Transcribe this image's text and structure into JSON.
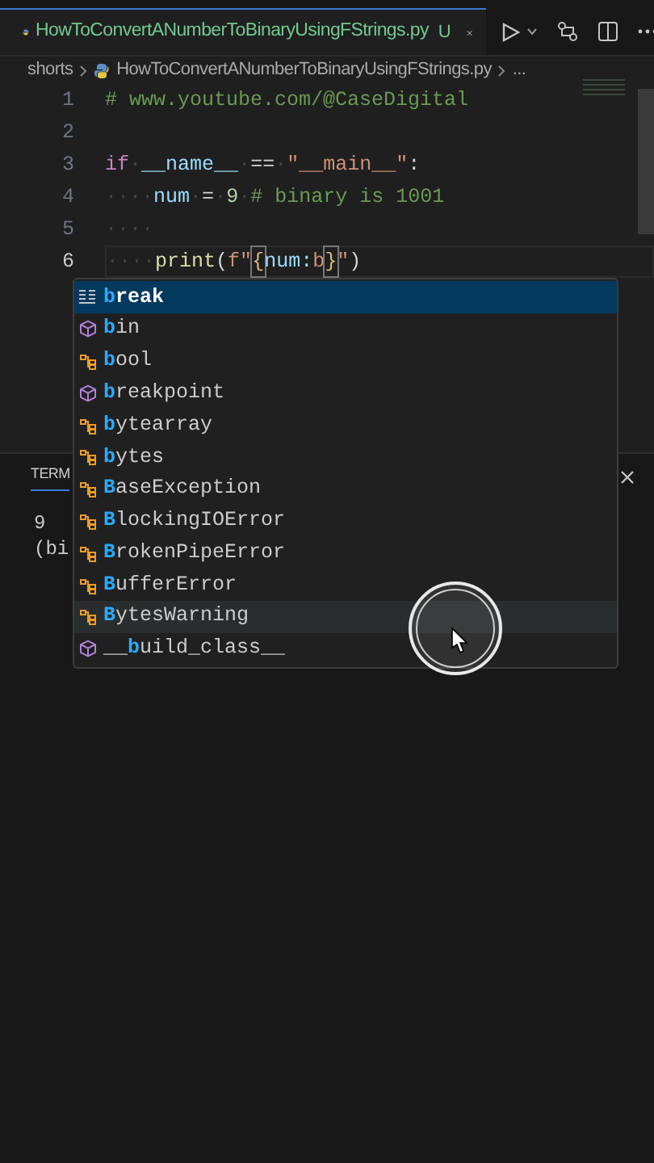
{
  "tab": {
    "filename": "HowToConvertANumberToBinaryUsingFStrings.py",
    "status": "U",
    "selected": true
  },
  "breadcrumb": [
    {
      "text": "shorts"
    },
    {
      "text": "HowToConvertANumberToBinaryUsingFStrings.py",
      "kind": "file"
    },
    {
      "text": "..."
    }
  ],
  "code_lines": [
    {
      "number": "1",
      "active": false,
      "tokens": [
        {
          "kind": "comment",
          "text": "# www.youtube.com/@CaseDigital"
        }
      ]
    },
    {
      "number": "2",
      "active": false
    },
    {
      "number": "3",
      "active": false,
      "tokens": [
        {
          "kind": "keyword",
          "text": "if"
        },
        {
          "kind": "space",
          "text": "·"
        },
        {
          "kind": "name",
          "text": "__name__"
        },
        {
          "kind": "space",
          "text": "·"
        },
        {
          "kind": "op",
          "text": "=="
        },
        {
          "kind": "space",
          "text": "·"
        },
        {
          "kind": "string",
          "text": "\"__main__\""
        },
        {
          "kind": "op",
          "text": ":"
        }
      ]
    },
    {
      "number": "4",
      "active": false,
      "tokens": [
        {
          "kind": "space",
          "text": "····"
        },
        {
          "kind": "name",
          "text": "num"
        },
        {
          "kind": "space",
          "text": "·"
        },
        {
          "kind": "op",
          "text": "="
        },
        {
          "kind": "space",
          "text": "·"
        },
        {
          "kind": "number",
          "text": "9"
        },
        {
          "kind": "space",
          "text": "·"
        },
        {
          "kind": "comment",
          "text": "# binary is 1001"
        }
      ]
    },
    {
      "number": "5",
      "active": false,
      "tokens": [
        {
          "kind": "space",
          "text": "····"
        }
      ]
    },
    {
      "number": "6",
      "active": true,
      "tokens": [
        {
          "kind": "space",
          "text": "····"
        },
        {
          "kind": "func",
          "text": "print"
        },
        {
          "kind": "op",
          "text": "("
        },
        {
          "kind": "string",
          "text": "f\""
        },
        {
          "kind": "bracket",
          "text": "{"
        },
        {
          "kind": "name",
          "text": "num:"
        },
        {
          "kind": "string",
          "text": "b"
        },
        {
          "kind": "bracket",
          "text": "}"
        },
        {
          "kind": "string",
          "text": "\""
        },
        {
          "kind": "op",
          "text": ")"
        }
      ]
    }
  ],
  "suggestions": [
    {
      "kind": "keyword",
      "match": "b",
      "rest": "reak",
      "selected": true,
      "hovered": false
    },
    {
      "kind": "function",
      "match": "b",
      "rest": "in",
      "selected": false,
      "hovered": false
    },
    {
      "kind": "class",
      "match": "b",
      "rest": "ool",
      "selected": false,
      "hovered": false
    },
    {
      "kind": "function",
      "match": "b",
      "rest": "reakpoint",
      "selected": false,
      "hovered": false
    },
    {
      "kind": "class",
      "match": "b",
      "rest": "ytearray",
      "selected": false,
      "hovered": false
    },
    {
      "kind": "class",
      "match": "b",
      "rest": "ytes",
      "selected": false,
      "hovered": false
    },
    {
      "kind": "class",
      "match": "B",
      "rest": "aseException",
      "selected": false,
      "hovered": false
    },
    {
      "kind": "class",
      "match": "B",
      "rest": "lockingIOError",
      "selected": false,
      "hovered": false
    },
    {
      "kind": "class",
      "match": "B",
      "rest": "rokenPipeError",
      "selected": false,
      "hovered": false
    },
    {
      "kind": "class",
      "match": "B",
      "rest": "ufferError",
      "selected": false,
      "hovered": false
    },
    {
      "kind": "class",
      "match": "B",
      "rest": "ytesWarning",
      "selected": false,
      "hovered": true
    },
    {
      "kind": "function",
      "lead": "__",
      "match": "b",
      "rest": "uild_class__",
      "selected": false,
      "hovered": false
    }
  ],
  "panel": {
    "tab": "TERM",
    "output": [
      "9",
      "(bi"
    ]
  }
}
